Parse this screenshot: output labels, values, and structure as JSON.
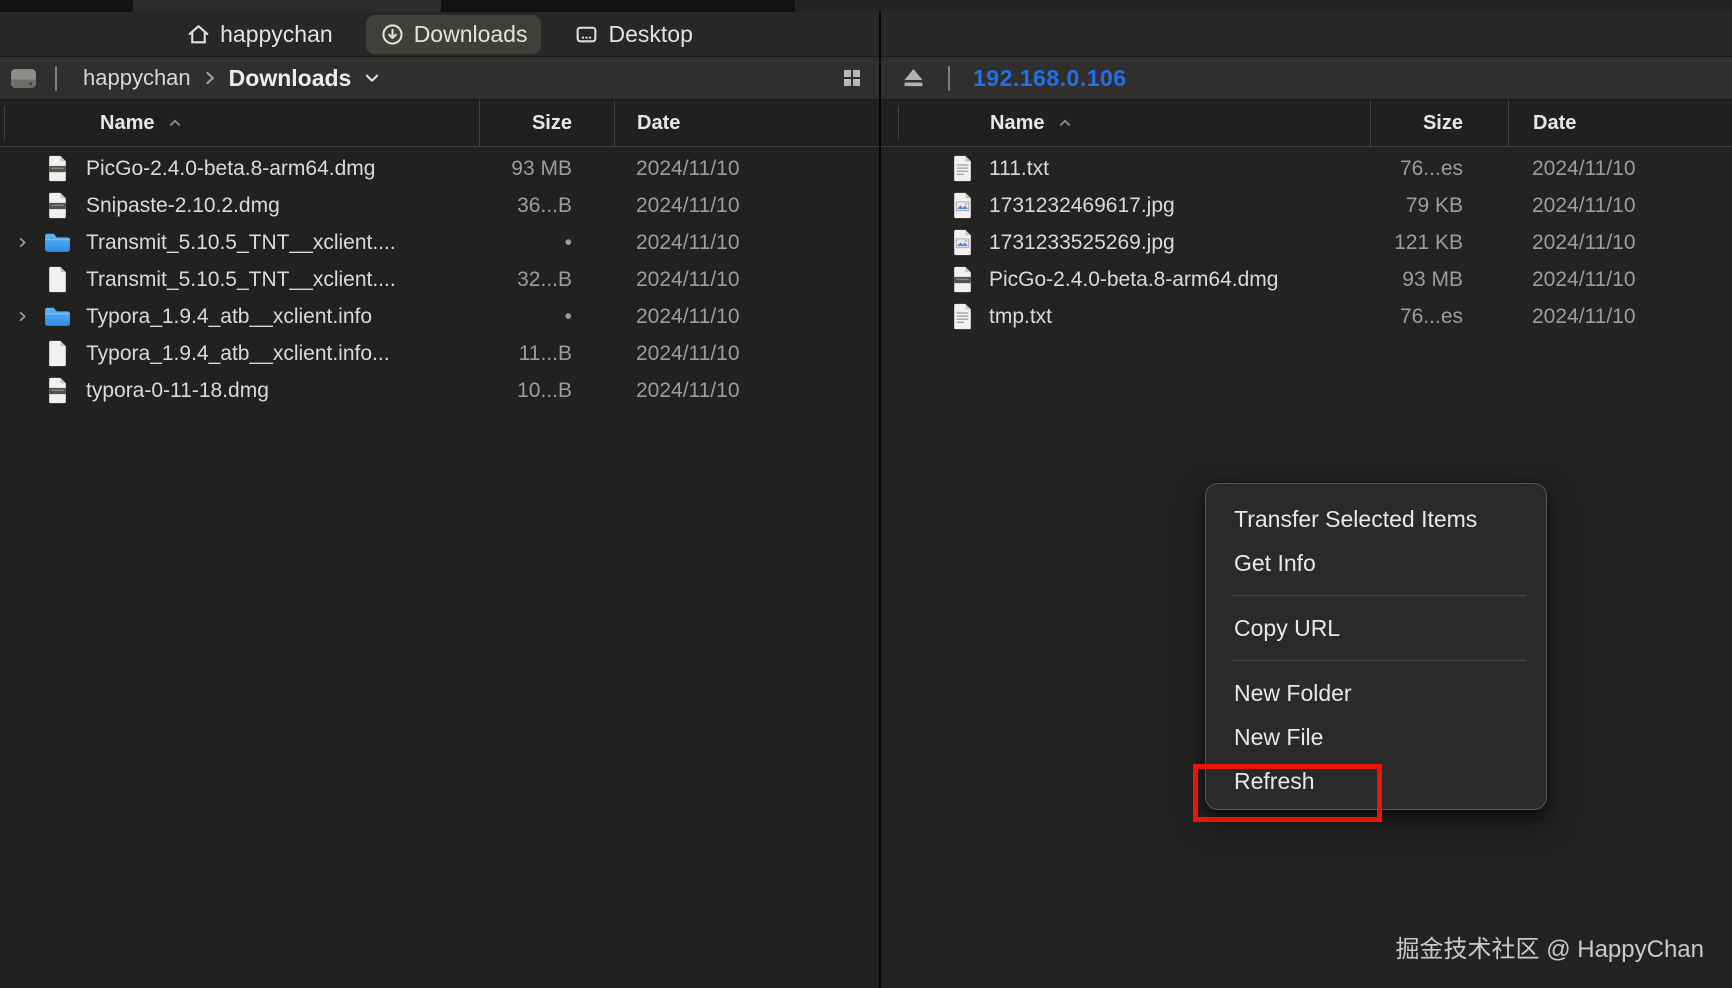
{
  "tabs": [
    {
      "label": "happychan",
      "icon": "home",
      "active": false
    },
    {
      "label": "Downloads",
      "icon": "downloads",
      "active": true
    },
    {
      "label": "Desktop",
      "icon": "desktop",
      "active": false
    }
  ],
  "left_pane": {
    "breadcrumb": {
      "root": "happychan",
      "current": "Downloads"
    },
    "columns": [
      "Name",
      "Size",
      "Date"
    ],
    "sorted_by": "Name",
    "files": [
      {
        "name": "PicGo-2.4.0-beta.8-arm64.dmg",
        "size": "93 MB",
        "date": "2024/11/10",
        "icon": "dmg",
        "expandable": false
      },
      {
        "name": "Snipaste-2.10.2.dmg",
        "size": "36...B",
        "date": "2024/11/10",
        "icon": "dmg",
        "expandable": false
      },
      {
        "name": "Transmit_5.10.5_TNT__xclient....",
        "size": "•",
        "date": "2024/11/10",
        "icon": "folder",
        "expandable": true
      },
      {
        "name": "Transmit_5.10.5_TNT__xclient....",
        "size": "32...B",
        "date": "2024/11/10",
        "icon": "file",
        "expandable": false
      },
      {
        "name": "Typora_1.9.4_atb__xclient.info",
        "size": "•",
        "date": "2024/11/10",
        "icon": "folder",
        "expandable": true
      },
      {
        "name": "Typora_1.9.4_atb__xclient.info...",
        "size": "11...B",
        "date": "2024/11/10",
        "icon": "file",
        "expandable": false
      },
      {
        "name": "typora-0-11-18.dmg",
        "size": "10...B",
        "date": "2024/11/10",
        "icon": "dmg",
        "expandable": false
      }
    ]
  },
  "right_pane": {
    "address": "192.168.0.106",
    "columns": [
      "Name",
      "Size",
      "Date"
    ],
    "sorted_by": "Name",
    "files": [
      {
        "name": "111.txt",
        "size": "76...es",
        "date": "2024/11/10",
        "icon": "txt",
        "expandable": false
      },
      {
        "name": "1731232469617.jpg",
        "size": "79 KB",
        "date": "2024/11/10",
        "icon": "jpg",
        "expandable": false
      },
      {
        "name": "1731233525269.jpg",
        "size": "121 KB",
        "date": "2024/11/10",
        "icon": "jpg",
        "expandable": false
      },
      {
        "name": "PicGo-2.4.0-beta.8-arm64.dmg",
        "size": "93 MB",
        "date": "2024/11/10",
        "icon": "dmg",
        "expandable": false
      },
      {
        "name": "tmp.txt",
        "size": "76...es",
        "date": "2024/11/10",
        "icon": "txt",
        "expandable": false
      }
    ]
  },
  "context_menu": {
    "items": [
      {
        "type": "item",
        "label": "Transfer Selected Items"
      },
      {
        "type": "item",
        "label": "Get Info"
      },
      {
        "type": "separator"
      },
      {
        "type": "item",
        "label": "Copy URL"
      },
      {
        "type": "separator"
      },
      {
        "type": "item",
        "label": "New Folder"
      },
      {
        "type": "item",
        "label": "New File"
      },
      {
        "type": "item",
        "label": "Refresh",
        "highlighted": true
      }
    ]
  },
  "watermark": "掘金技术社区 @ HappyChan",
  "colors": {
    "accent_blue": "#2270e8",
    "highlight_red": "#e8150b",
    "folder_blue": "#3b9aec",
    "active_tab_bg": "#413f3c"
  }
}
